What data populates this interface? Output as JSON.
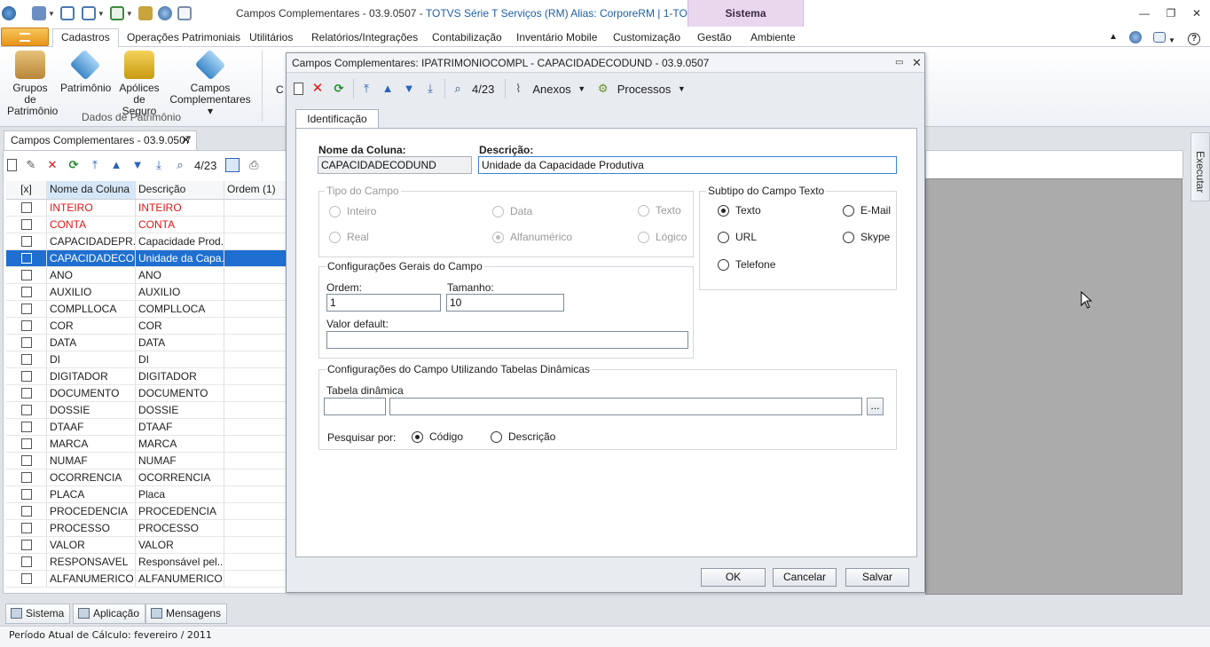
{
  "window": {
    "title_main": "Campos Complementares - 03.9.0507 - ",
    "title_hl": "TOTVS Série T Serviços (RM) Alias: CorporeRM | 1-TOTVS SA",
    "context_tab": "Sistema",
    "minimize": "—",
    "restore": "❐",
    "close": "✕"
  },
  "ribbon_tabs": [
    "Cadastros",
    "Operações Patrimoniais",
    "Utilitários",
    "Relatórios/Integrações",
    "Contabilização",
    "Inventário Mobile",
    "Customização",
    "Gestão",
    "Ambiente"
  ],
  "ribbon": {
    "items": [
      {
        "line1": "Grupos de",
        "line2": "Patrimônio"
      },
      {
        "line1": "Patrimônio",
        "line2": ""
      },
      {
        "line1": "Apólices",
        "line2": "de Seguro"
      },
      {
        "line1": "Campos",
        "line2": "Complementares ▾"
      }
    ],
    "group_label": "Dados de Patrimônio",
    "partial": "C"
  },
  "doc_tab": {
    "label": "Campos Complementares - 03.9.0507",
    "close": "✕"
  },
  "left_toolbar": {
    "record_count": "4/23"
  },
  "grid": {
    "headers": [
      "[x]",
      "Nome da Coluna",
      "Descrição",
      "Ordem (1)"
    ],
    "rows": [
      {
        "name": "INTEIRO",
        "desc": "INTEIRO",
        "style": "red"
      },
      {
        "name": "CONTA",
        "desc": "CONTA",
        "style": "red"
      },
      {
        "name": "CAPACIDADEPR...",
        "desc": "Capacidade Prod...",
        "style": ""
      },
      {
        "name": "CAPACIDADECO...",
        "desc": "Unidade da Capa...",
        "style": "sel"
      },
      {
        "name": "ANO",
        "desc": "ANO",
        "style": ""
      },
      {
        "name": "AUXILIO",
        "desc": "AUXILIO",
        "style": ""
      },
      {
        "name": "COMPLLOCA",
        "desc": "COMPLLOCA",
        "style": ""
      },
      {
        "name": "COR",
        "desc": "COR",
        "style": ""
      },
      {
        "name": "DATA",
        "desc": "DATA",
        "style": ""
      },
      {
        "name": "DI",
        "desc": "DI",
        "style": ""
      },
      {
        "name": "DIGITADOR",
        "desc": "DIGITADOR",
        "style": ""
      },
      {
        "name": "DOCUMENTO",
        "desc": "DOCUMENTO",
        "style": ""
      },
      {
        "name": "DOSSIE",
        "desc": "DOSSIE",
        "style": ""
      },
      {
        "name": "DTAAF",
        "desc": "DTAAF",
        "style": ""
      },
      {
        "name": "MARCA",
        "desc": "MARCA",
        "style": ""
      },
      {
        "name": "NUMAF",
        "desc": "NUMAF",
        "style": ""
      },
      {
        "name": "OCORRENCIA",
        "desc": "OCORRENCIA",
        "style": ""
      },
      {
        "name": "PLACA",
        "desc": "Placa",
        "style": ""
      },
      {
        "name": "PROCEDENCIA",
        "desc": "PROCEDENCIA",
        "style": ""
      },
      {
        "name": "PROCESSO",
        "desc": "PROCESSO",
        "style": ""
      },
      {
        "name": "VALOR",
        "desc": "VALOR",
        "style": ""
      },
      {
        "name": "RESPONSAVEL",
        "desc": "Responsável pel...",
        "style": ""
      },
      {
        "name": "ALFANUMERICO",
        "desc": "ALFANUMERICO",
        "style": ""
      }
    ]
  },
  "executar": "Executar",
  "dialog": {
    "title": "Campos Complementares: IPATRIMONIOCOMPL - CAPACIDADECODUND - 03.9.0507",
    "record_count": "4/23",
    "anexos": "Anexos",
    "processos": "Processos",
    "tab": "Identificação",
    "nome_label": "Nome da Coluna:",
    "nome_value": "CAPACIDADECODUND",
    "desc_label": "Descrição:",
    "desc_value": "Unidade da Capacidade Produtiva",
    "tipo_title": "Tipo do Campo",
    "tipo_options": {
      "inteiro": "Inteiro",
      "data": "Data",
      "texto": "Texto",
      "real": "Real",
      "alfa": "Alfanumérico",
      "logico": "Lógico"
    },
    "subtipo_title": "Subtipo do Campo Texto",
    "subtipo_options": {
      "texto": "Texto",
      "email": "E-Mail",
      "url": "URL",
      "skype": "Skype",
      "telefone": "Telefone"
    },
    "config_title": "Configurações Gerais do Campo",
    "ordem_label": "Ordem:",
    "ordem_value": "1",
    "tamanho_label": "Tamanho:",
    "tamanho_value": "10",
    "default_label": "Valor default:",
    "default_value": "",
    "dyn_title": "Configurações do Campo Utilizando Tabelas Dinâmicas",
    "dyn_label": "Tabela dinâmica",
    "dyn_browse": "...",
    "pesquisar_label": "Pesquisar por:",
    "pesq_codigo": "Código",
    "pesq_descricao": "Descrição",
    "ok": "OK",
    "cancelar": "Cancelar",
    "salvar": "Salvar"
  },
  "bottom_tabs": [
    "Sistema",
    "Aplicação",
    "Mensagens"
  ],
  "status": "Período Atual de Cálculo: fevereiro / 2011",
  "colors": {
    "selection": "#1e6fd0",
    "red_row": "#e01515",
    "context_tab": "#e9d7ee",
    "file_button": "#e8941a"
  }
}
